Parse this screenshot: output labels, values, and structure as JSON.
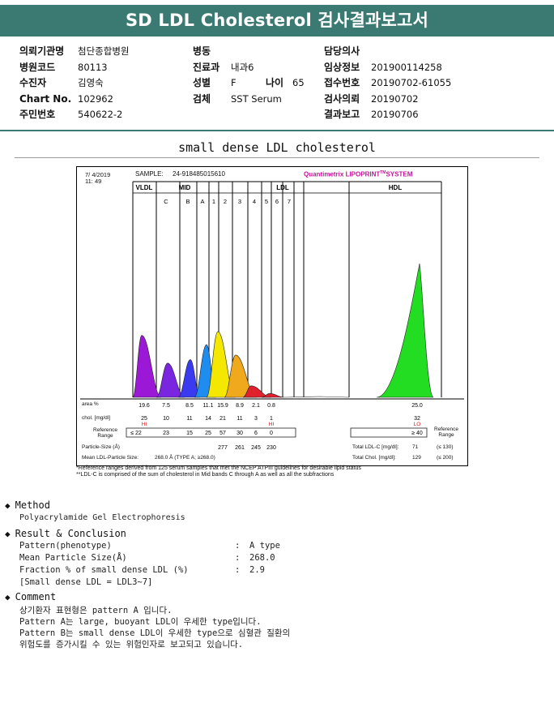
{
  "report": {
    "title": "SD LDL Cholesterol 검사결과보고서"
  },
  "patient_info": {
    "col1": [
      {
        "label": "의뢰기관명",
        "value": "첨단종합병원"
      },
      {
        "label": "병원코드",
        "value": "80113"
      },
      {
        "label": "수진자",
        "value": "김영숙"
      },
      {
        "label": "Chart No.",
        "value": "102962"
      },
      {
        "label": "주민번호",
        "value": "540622-2"
      }
    ],
    "col2": [
      {
        "label": "병동",
        "value": ""
      },
      {
        "label": "진료과",
        "value": "내과6"
      },
      {
        "label": "성별",
        "value": "F"
      },
      {
        "label": "검체",
        "value": "SST Serum"
      }
    ],
    "age": {
      "label": "나이",
      "value": "65"
    },
    "col3": [
      {
        "label": "담당의사",
        "value": ""
      },
      {
        "label": "임상정보",
        "value": "201900114258"
      },
      {
        "label": "접수번호",
        "value": "20190702-61055"
      },
      {
        "label": "검사의뢰",
        "value": "20190702"
      },
      {
        "label": "결과보고",
        "value": "20190706"
      }
    ]
  },
  "section_title": "small dense LDL cholesterol",
  "chart": {
    "date": "7/ 4/2019",
    "time": "11: 49",
    "sample_label": "SAMPLE:",
    "sample_id": "24-918485015610",
    "brand": "Quantimetrix LIPOPRINT",
    "brand_tm": "TM",
    "brand_suffix": "SYSTEM",
    "group_labels": [
      "VLDL",
      "MID",
      "LDL",
      "HDL"
    ],
    "band_labels": [
      "C",
      "B",
      "A",
      "1",
      "2",
      "3",
      "4",
      "5",
      "6",
      "7"
    ],
    "row_labels": {
      "area": "area %",
      "chol": "chol. [mg/dl]",
      "ref": "Reference Range",
      "size": "Particle-Size (Å)",
      "mean": "Mean LDL-Particle Size:"
    },
    "area_values": [
      "19.6",
      "7.5",
      "8.5",
      "11.1",
      "15.9",
      "8.9",
      "2.1",
      "0.8",
      "25.0"
    ],
    "chol_values": [
      "25",
      "10",
      "11",
      "14",
      "21",
      "11",
      "3",
      "1",
      "32"
    ],
    "chol_flags": [
      {
        "col": 0,
        "text": "HI"
      },
      {
        "col": 7,
        "text": "HI"
      },
      {
        "col": 8,
        "text": "LO"
      }
    ],
    "ref_values": [
      "≤ 22",
      "23",
      "15",
      "25",
      "57",
      "30",
      "6",
      "0",
      "≥ 40"
    ],
    "ref_right_label": "Reference Range",
    "size_values": [
      "277",
      "261",
      "245",
      "230"
    ],
    "mean_size_text": "268.0 Å  (TYPE A; ≥268.0)",
    "total_ldl_label": "Total LDL-C [mg/dl]:",
    "total_ldl_value": "71",
    "total_ldl_range": "(≤ 130)",
    "total_chol_label": "Total Chol. [mg/dl]:",
    "total_chol_value": "129",
    "total_chol_range": "(≤ 200)",
    "footnote1": "*Reference ranges derived from 125 serum samples that met the NCEP ATPIII guidelines for desirable lipid status",
    "footnote2": "**LDL-C is comprised of the sum of cholesterol in Mid bands C through A as well as all the subfractions",
    "colors": {
      "vldl": "#9b19d6",
      "midC": "#7a25e0",
      "midB": "#3a3af0",
      "midA": "#1f8cf0",
      "ldl1": "#f5e800",
      "ldl2": "#f0a81c",
      "ldl3": "#e0202c",
      "hdl": "#22dd22",
      "accent": "#3b7a72"
    }
  },
  "chart_data": {
    "type": "area",
    "title": "small dense LDL cholesterol",
    "categories": [
      "VLDL",
      "MID C",
      "MID B",
      "MID A",
      "LDL 1",
      "LDL 2",
      "LDL 3",
      "LDL 4",
      "HDL"
    ],
    "series": [
      {
        "name": "area %",
        "values": [
          19.6,
          7.5,
          8.5,
          11.1,
          15.9,
          8.9,
          2.1,
          0.8,
          25.0
        ]
      },
      {
        "name": "chol. [mg/dl]",
        "values": [
          25,
          10,
          11,
          14,
          21,
          11,
          3,
          1,
          32
        ]
      }
    ],
    "particle_size_A": {
      "LDL 1": 277,
      "LDL 2": 261,
      "LDL 3": 245,
      "LDL 4": 230
    },
    "mean_ldl_particle_size_A": 268.0,
    "total_ldl_c": 71,
    "total_chol": 129
  },
  "method": {
    "heading": "Method",
    "text": "Polyacrylamide Gel Electrophoresis"
  },
  "result": {
    "heading": "Result & Conclusion",
    "rows": [
      {
        "label": "Pattern(phenotype)",
        "sep": ":",
        "value": "A type"
      },
      {
        "label": "Mean Particle Size(Å)",
        "sep": ":",
        "value": "268.0"
      },
      {
        "label": "Fraction % of small dense LDL (%)",
        "sep": ":",
        "value": "2.9"
      }
    ],
    "note": "[Small dense LDL = LDL3~7]"
  },
  "comment": {
    "heading": "Comment",
    "lines": [
      "상기환자 표현형은 pattern A 입니다.",
      "Pattern A는 large, buoyant LDL이 우세한 type입니다.",
      "Pattern B는 small dense LDL이 우세한 type으로 심혈관 질환의",
      "위험도를 증가시킬 수 있는 위험인자로 보고되고 있습니다."
    ]
  }
}
